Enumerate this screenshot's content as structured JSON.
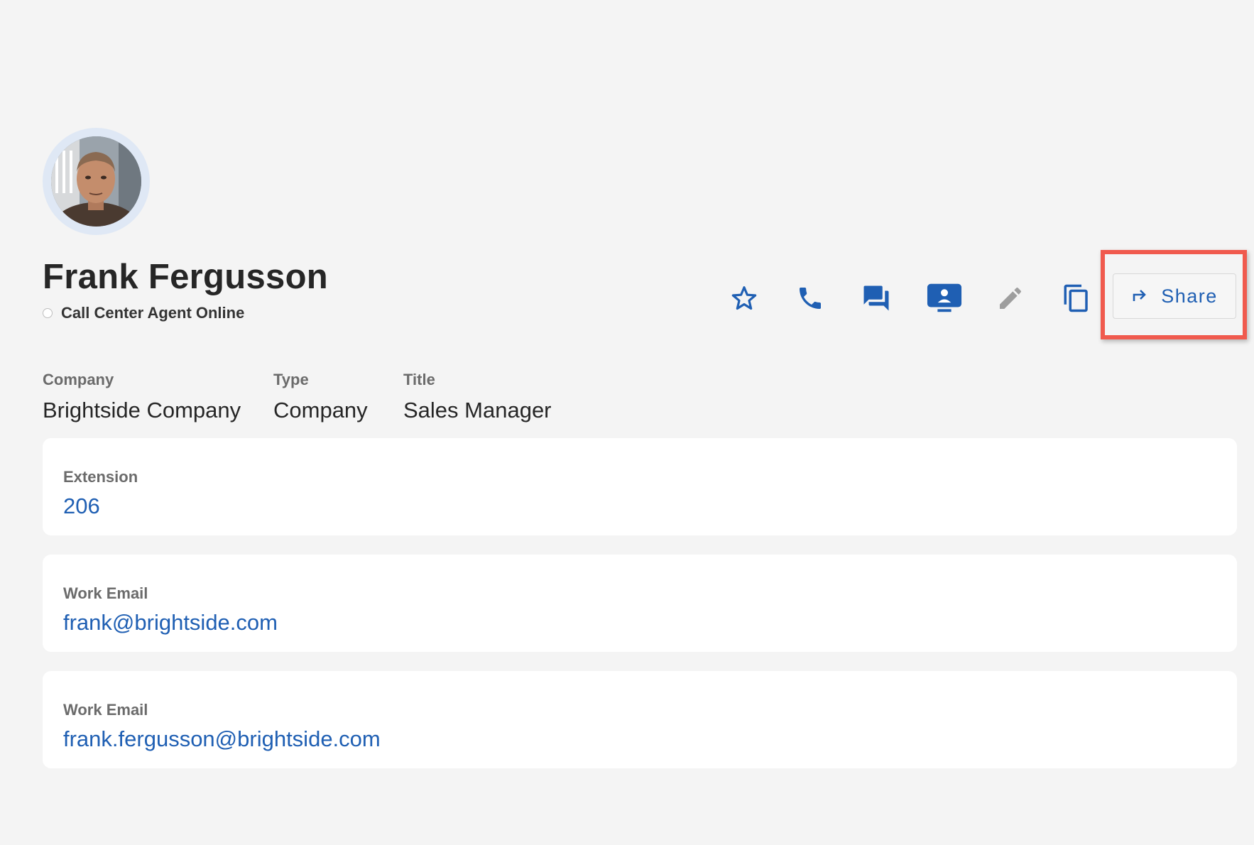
{
  "contact": {
    "name": "Frank Fergusson",
    "status": "Call Center Agent Online"
  },
  "actions": {
    "favorite": "star-icon",
    "call": "phone-icon",
    "chat": "chat-icon",
    "meeting": "screen-share-icon",
    "edit": "pencil-icon",
    "copy": "copy-icon",
    "share_label": "Share"
  },
  "details": {
    "company_label": "Company",
    "company_value": "Brightside Company",
    "type_label": "Type",
    "type_value": "Company",
    "title_label": "Title",
    "title_value": "Sales Manager"
  },
  "cards": [
    {
      "label": "Extension",
      "value": "206"
    },
    {
      "label": "Work Email",
      "value": "frank@brightside.com"
    },
    {
      "label": "Work Email",
      "value": "frank.fergusson@brightside.com"
    }
  ],
  "colors": {
    "accent": "#1f5fb3",
    "highlight": "#f05a4e",
    "background": "#f4f4f4",
    "edit_disabled": "#9e9e9e"
  }
}
